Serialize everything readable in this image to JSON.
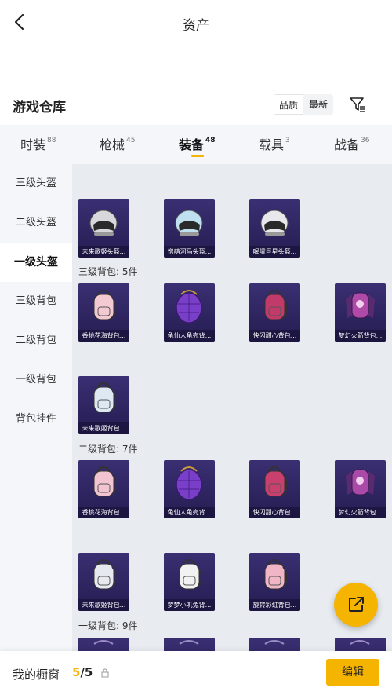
{
  "header": {
    "title": "资产",
    "back_icon": "chevron-left-icon"
  },
  "warehouse": {
    "title": "游戏仓库",
    "sort_options": [
      "品质",
      "最新"
    ],
    "filter_icon": "filter-icon"
  },
  "tabs": [
    {
      "label": "时装",
      "count": "88"
    },
    {
      "label": "枪械",
      "count": "45"
    },
    {
      "label": "装备",
      "count": "48",
      "active": true
    },
    {
      "label": "载具",
      "count": "3"
    },
    {
      "label": "战备",
      "count": "36"
    }
  ],
  "sidebar": [
    {
      "label": "三级头盔"
    },
    {
      "label": "二级头盔"
    },
    {
      "label": "一级头盔",
      "active": true
    },
    {
      "label": "三级背包"
    },
    {
      "label": "二级背包"
    },
    {
      "label": "一级背包"
    },
    {
      "label": "背包挂件"
    }
  ],
  "groups": [
    {
      "label": "三级背包: 5件"
    },
    {
      "label": "二级背包: 7件"
    },
    {
      "label": "一级背包: 9件"
    }
  ],
  "items": [
    {
      "name": "未来歌姬头盔...",
      "kind": "helmet",
      "color": "#d8d8dc"
    },
    {
      "name": "憎萌河马头盔...",
      "kind": "helmet",
      "color": "#bfe0f0"
    },
    {
      "name": "喔嚯巨星头盔...",
      "kind": "helmet",
      "color": "#e8e8ec"
    },
    {
      "name": "香桃花海背包...",
      "kind": "backpack",
      "color": "#f3c9d2"
    },
    {
      "name": "龟仙人龟壳背...",
      "kind": "shell",
      "color": "#7a3fc8"
    },
    {
      "name": "快闪甜心背包...",
      "kind": "backpack",
      "color": "#c23a6a"
    },
    {
      "name": "梦幻火箭背包...",
      "kind": "rocket",
      "color": "#b04aa8"
    },
    {
      "name": "未来歌姬背包...",
      "kind": "backpack",
      "color": "#dde8f2"
    },
    {
      "name": "香桃花海背包...",
      "kind": "backpack",
      "color": "#f1c4cf"
    },
    {
      "name": "龟仙人龟壳背...",
      "kind": "shell",
      "color": "#7a3fc8"
    },
    {
      "name": "快闪甜心背包...",
      "kind": "backpack",
      "color": "#c9406e"
    },
    {
      "name": "梦幻火箭背包...",
      "kind": "rocket",
      "color": "#a94aa8"
    },
    {
      "name": "未来歌姬背包...",
      "kind": "backpack",
      "color": "#e6eaf0"
    },
    {
      "name": "梦梦小叽兔背...",
      "kind": "backpack",
      "color": "#f2f2f2"
    },
    {
      "name": "旋转彩虹背包...",
      "kind": "backpack",
      "color": "#f0b6c6"
    },
    {
      "name": "",
      "kind": "partial",
      "color": "#3a2f72"
    },
    {
      "name": "",
      "kind": "partial",
      "color": "#3a2f72"
    },
    {
      "name": "",
      "kind": "partial",
      "color": "#3a2f72"
    },
    {
      "name": "",
      "kind": "partial",
      "color": "#3a2f72"
    }
  ],
  "fab": {
    "icon": "share-export-icon"
  },
  "bottom": {
    "cabinet_label": "我的橱窗",
    "cabinet_current": "5",
    "cabinet_total": "/5",
    "lock_icon": "lock-icon",
    "edit_label": "编辑"
  },
  "colors": {
    "accent": "#f5b400",
    "card": "#2d2460"
  }
}
